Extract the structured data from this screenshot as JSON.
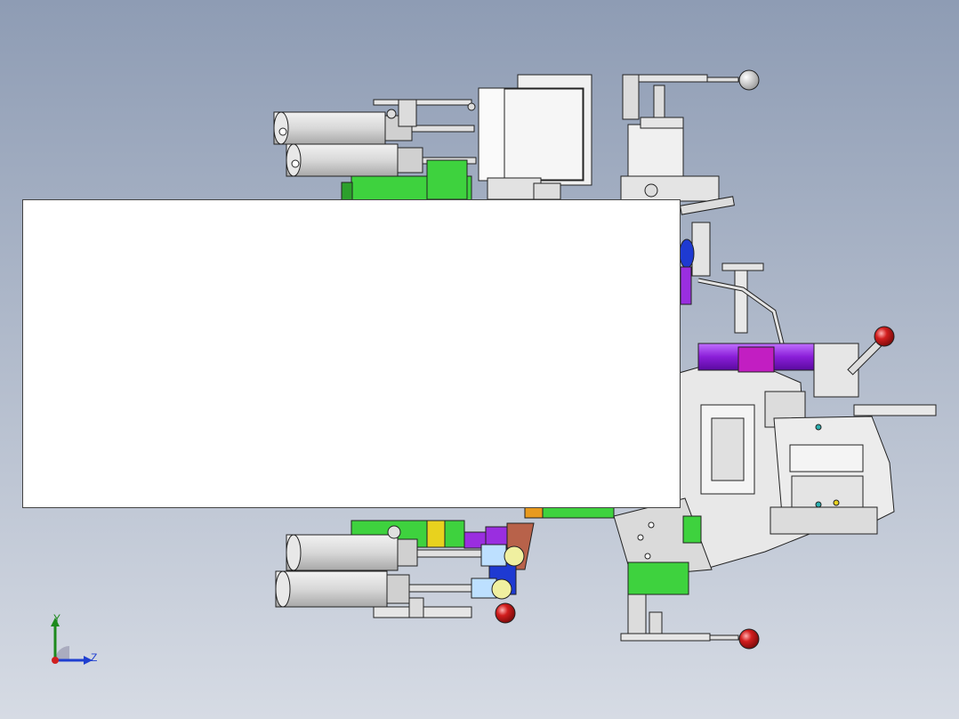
{
  "viewport": {
    "background_top": "#8e9cb4",
    "background_bottom": "#d6dbe4"
  },
  "triad": {
    "y_label": "Y",
    "z_label": "Z",
    "y_color": "#1d8a1d",
    "z_color": "#1f3fd0",
    "origin_color": "#d02020"
  },
  "parts_colors": {
    "green": "#3ed23e",
    "purple": "#9a2ee0",
    "magenta": "#c21ec2",
    "yellow": "#e8d21e",
    "orange": "#e89a1e",
    "blue": "#1e3ad2",
    "brown": "#b8624a",
    "red_knob": "#d21e1e",
    "gray_body": "#dcdcdc",
    "outline": "#222222"
  }
}
